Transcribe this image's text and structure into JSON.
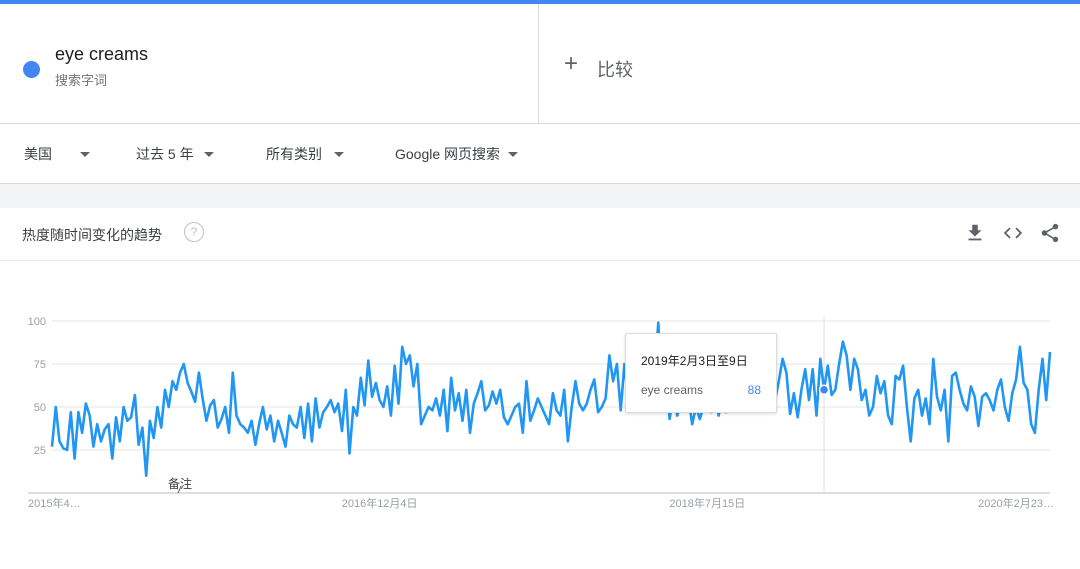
{
  "search_term": {
    "name": "eye creams",
    "type_label": "搜索字词",
    "dot_color": "#4285f4"
  },
  "compare": {
    "plus": "+",
    "label": "比较"
  },
  "filters": {
    "region": "美国",
    "time_range": "过去 5 年",
    "category": "所有类别",
    "search_type": "Google 网页搜索"
  },
  "panel": {
    "title": "热度随时间变化的趋势",
    "help_icon": "?",
    "icons": [
      "download-icon",
      "embed-code-icon",
      "share-icon"
    ]
  },
  "tooltip": {
    "date": "2019年2月3日至9日",
    "term": "eye creams",
    "value": "88"
  },
  "chart_data": {
    "type": "line",
    "title": "热度随时间变化的趋势",
    "ylim": [
      0,
      100
    ],
    "yticks": [
      25,
      50,
      75,
      100
    ],
    "grid": true,
    "x_tick_labels": [
      "2015年4…",
      "2016年12月4日",
      "2018年7月15日",
      "2020年2月23…"
    ],
    "x_tick_index": [
      0,
      87,
      174,
      260
    ],
    "annotation": {
      "label": "备注",
      "index": 34
    },
    "highlight_index": 205,
    "line_color": "#2196f3",
    "series": [
      {
        "name": "eye creams",
        "values": [
          27,
          50,
          30,
          26,
          25,
          47,
          20,
          47,
          35,
          52,
          45,
          27,
          40,
          30,
          37,
          40,
          20,
          44,
          30,
          50,
          42,
          44,
          57,
          28,
          38,
          10,
          42,
          32,
          50,
          38,
          60,
          50,
          65,
          60,
          70,
          75,
          64,
          59,
          53,
          70,
          55,
          42,
          51,
          54,
          38,
          43,
          50,
          35,
          70,
          45,
          40,
          38,
          35,
          42,
          28,
          40,
          50,
          37,
          45,
          30,
          42,
          35,
          27,
          45,
          40,
          38,
          50,
          32,
          52,
          30,
          55,
          38,
          47,
          50,
          54,
          47,
          52,
          36,
          60,
          23,
          50,
          45,
          67,
          51,
          77,
          56,
          64,
          54,
          50,
          62,
          45,
          74,
          52,
          85,
          75,
          80,
          62,
          75,
          40,
          45,
          50,
          48,
          55,
          45,
          60,
          36,
          67,
          48,
          58,
          42,
          60,
          35,
          52,
          58,
          65,
          48,
          51,
          59,
          52,
          60,
          44,
          40,
          45,
          50,
          52,
          35,
          65,
          42,
          48,
          55,
          50,
          45,
          40,
          58,
          48,
          45,
          60,
          30,
          50,
          65,
          52,
          48,
          52,
          60,
          66,
          47,
          50,
          55,
          80,
          65,
          75,
          48,
          75,
          55,
          70,
          53,
          56,
          49,
          66,
          60,
          70,
          99,
          55,
          76,
          43,
          58,
          45,
          52,
          70,
          55,
          40,
          50,
          43,
          50,
          62,
          47,
          65,
          45,
          55,
          47,
          62,
          48,
          70,
          60,
          75,
          65,
          52,
          78,
          48,
          80,
          65,
          70,
          54,
          65,
          78,
          70,
          46,
          58,
          44,
          60,
          72,
          54,
          72,
          45,
          78,
          60,
          74,
          57,
          60,
          75,
          88,
          80,
          60,
          78,
          72,
          54,
          60,
          45,
          50,
          68,
          58,
          65,
          45,
          40,
          68,
          66,
          74,
          50,
          30,
          55,
          60,
          45,
          55,
          40,
          78,
          56,
          48,
          60,
          30,
          68,
          70,
          60,
          52,
          48,
          62,
          56,
          39,
          56,
          58,
          54,
          48,
          60,
          66,
          50,
          42,
          58,
          66,
          85,
          64,
          60,
          40,
          35,
          60,
          78,
          54,
          82
        ]
      }
    ]
  }
}
